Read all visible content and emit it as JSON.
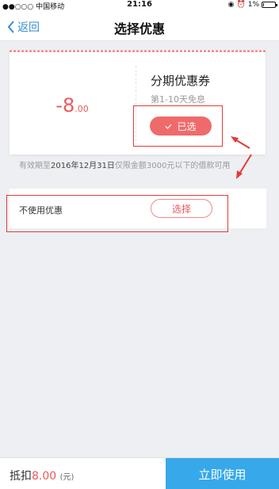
{
  "status_bar": {
    "carrier": "●●○○○ 中国移动",
    "time": "21:16",
    "battery": "1%"
  },
  "nav": {
    "back_label": "返回",
    "title": "选择优惠"
  },
  "coupon": {
    "amount_main": "-8",
    "amount_decimal": ".00",
    "title": "分期优惠券",
    "term": "第1-10天免息",
    "selected_label": "已选"
  },
  "validity": {
    "prefix": "有效期至",
    "date": "2016年12月31日",
    "suffix": "仅限金额3000元以下的借款可用"
  },
  "no_coupon": {
    "label": "不使用优惠",
    "choose_label": "选择"
  },
  "bottom": {
    "deduct_prefix": "抵扣",
    "deduct_amount": "8.00",
    "deduct_unit": "(元)",
    "use_label": "立即使用"
  },
  "colors": {
    "accent_red": "#ef6b6b",
    "accent_blue": "#37a8ea",
    "link_blue": "#3a8bd6"
  }
}
